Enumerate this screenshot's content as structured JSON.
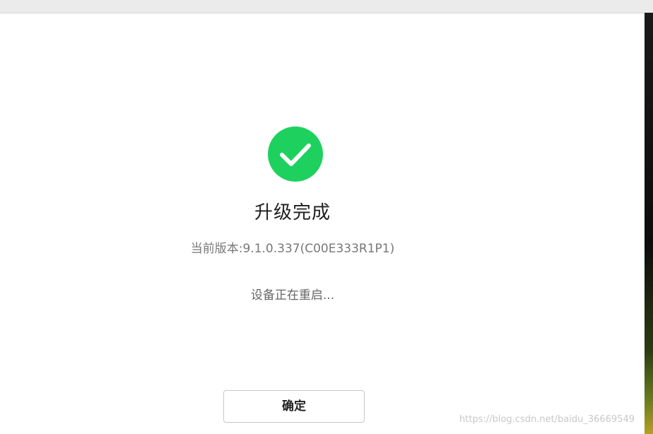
{
  "dialog": {
    "title": "升级完成",
    "version_text": "当前版本:9.1.0.337(C00E333R1P1)",
    "status_text": "设备正在重启...",
    "confirm_label": "确定",
    "success_icon": "check-circle-icon",
    "accent_color": "#1ed15f"
  },
  "watermark": {
    "text": "https://blog.csdn.net/baidu_36669549"
  }
}
